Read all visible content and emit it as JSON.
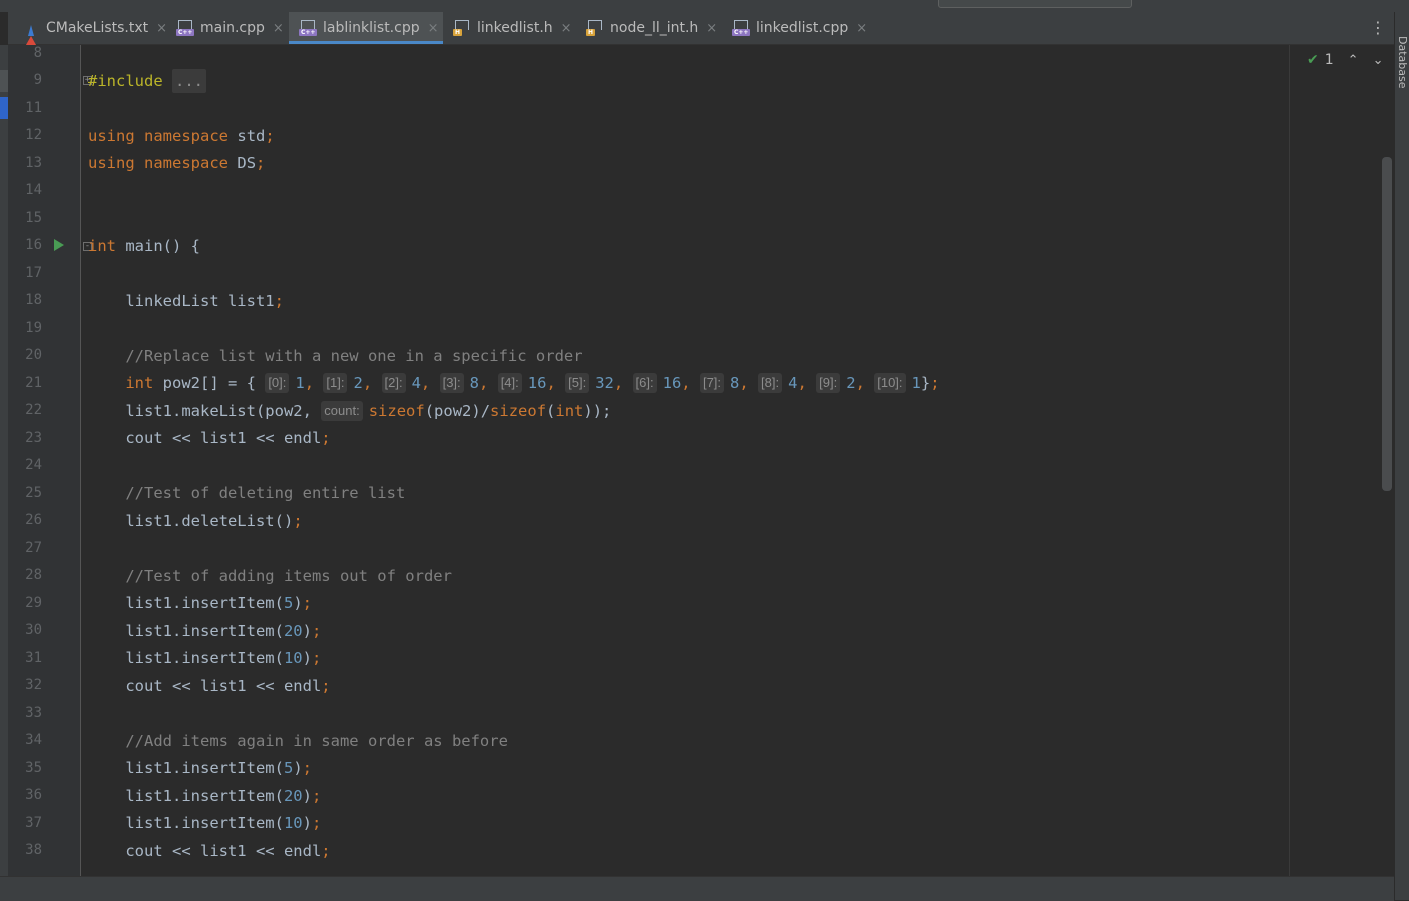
{
  "tabs": [
    {
      "label": "CMakeLists.txt",
      "icon": "cmake-icon",
      "badge": "",
      "badge_color": "",
      "active": false
    },
    {
      "label": "main.cpp",
      "icon": "cpp-file-icon",
      "badge": "C++",
      "badge_color": "#8d76c1",
      "active": false
    },
    {
      "label": "lablinklist.cpp",
      "icon": "cpp-file-icon",
      "badge": "C++",
      "badge_color": "#8d76c1",
      "active": true
    },
    {
      "label": "linkedlist.h",
      "icon": "header-file-icon",
      "badge": "H",
      "badge_color": "#d8a33b",
      "active": false
    },
    {
      "label": "node_ll_int.h",
      "icon": "header-file-icon",
      "badge": "H",
      "badge_color": "#d8a33b",
      "active": false
    },
    {
      "label": "linkedlist.cpp",
      "icon": "cpp-file-icon",
      "badge": "C++",
      "badge_color": "#8d76c1",
      "active": false
    }
  ],
  "close_glyph": "×",
  "more_menu": "⋮",
  "line_numbers": [
    "8",
    "9",
    "11",
    "12",
    "13",
    "14",
    "15",
    "16",
    "17",
    "18",
    "19",
    "20",
    "21",
    "22",
    "23",
    "24",
    "25",
    "26",
    "27",
    "28",
    "29",
    "30",
    "31",
    "32",
    "33",
    "34",
    "35",
    "36",
    "37",
    "38"
  ],
  "code": {
    "include_directive": "#include",
    "include_folded": "...",
    "using": "using",
    "namespace": "namespace",
    "std": "std",
    "ds": "DS",
    "semi": ";",
    "int": "int",
    "main_sig": " main() {",
    "l18": "    linkedList list1",
    "c20": "    //Replace list with a new one in a specific order",
    "pow2_decl": " pow2[] = { ",
    "pow2_hints": [
      "[0]:",
      "[1]:",
      "[2]:",
      "[3]:",
      "[4]:",
      "[5]:",
      "[6]:",
      "[7]:",
      "[8]:",
      "[9]:",
      "[10]:"
    ],
    "pow2_values": [
      "1",
      "2",
      "4",
      "8",
      "16",
      "32",
      "16",
      "8",
      "4",
      "2",
      "1"
    ],
    "pow2_close": "}",
    "l22_a": "    list1.makeList(pow2, ",
    "l22_hint": "count:",
    "sizeof": "sizeof",
    "l22_b": "(pow2)/",
    "l22_c": "(",
    "l22_d": "));",
    "cout": "    cout << list1 << endl",
    "c25": "    //Test of deleting entire list",
    "l26": "    list1.deleteList()",
    "c28": "    //Test of adding items out of order",
    "insert_prefix": "    list1.insertItem(",
    "insert_suffix": ")",
    "insert_values": [
      "5",
      "20",
      "10"
    ],
    "c34": "    //Add items again in same order as before"
  },
  "inspection": {
    "count": "1",
    "check": "✔",
    "up": "⌃",
    "down": "⌄"
  },
  "side_panel_label": "Database"
}
